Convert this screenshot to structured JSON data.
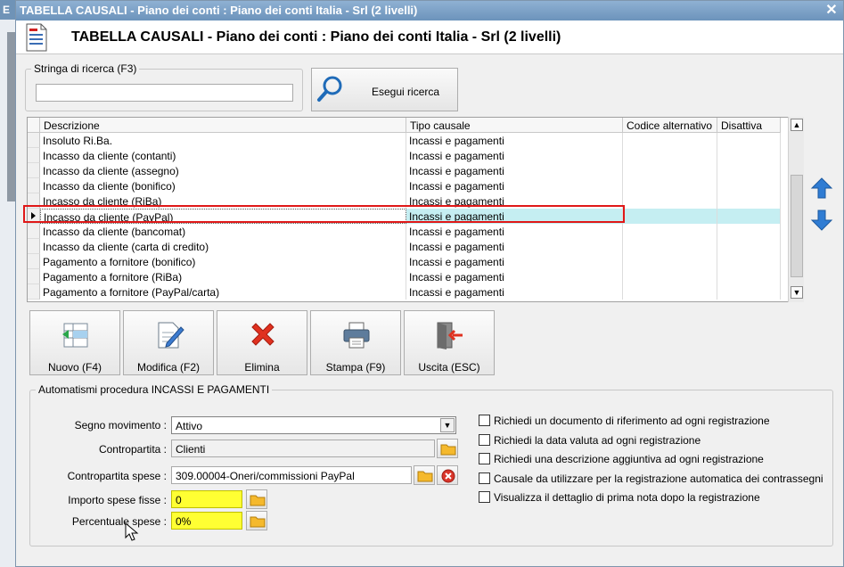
{
  "background_window": {
    "title_fragment": "E"
  },
  "window": {
    "title": "TABELLA CAUSALI - Piano dei conti : Piano dei conti Italia - Srl (2 livelli)",
    "close_label": "✕"
  },
  "header": {
    "title": "TABELLA CAUSALI - Piano dei conti : Piano dei conti Italia - Srl (2 livelli)",
    "icon": "document-icon"
  },
  "search": {
    "group_label": "Stringa di ricerca (F3)",
    "value": "",
    "placeholder": "",
    "button_label": "Esegui ricerca"
  },
  "grid": {
    "columns": [
      "Descrizione",
      "Tipo causale",
      "Codice alternativo",
      "Disattiva"
    ],
    "rows": [
      {
        "descrizione": "Insoluto Ri.Ba.",
        "tipo": "Incassi e pagamenti",
        "codice": "",
        "disattiva": ""
      },
      {
        "descrizione": "Incasso da cliente (contanti)",
        "tipo": "Incassi e pagamenti",
        "codice": "",
        "disattiva": ""
      },
      {
        "descrizione": "Incasso da cliente (assegno)",
        "tipo": "Incassi e pagamenti",
        "codice": "",
        "disattiva": ""
      },
      {
        "descrizione": "Incasso da cliente (bonifico)",
        "tipo": "Incassi e pagamenti",
        "codice": "",
        "disattiva": ""
      },
      {
        "descrizione": "Incasso da cliente (RiBa)",
        "tipo": "Incassi e pagamenti",
        "codice": "",
        "disattiva": ""
      },
      {
        "descrizione": "Incasso da cliente (PayPal)",
        "tipo": "Incassi e pagamenti",
        "codice": "",
        "disattiva": ""
      },
      {
        "descrizione": "Incasso da cliente (bancomat)",
        "tipo": "Incassi e pagamenti",
        "codice": "",
        "disattiva": ""
      },
      {
        "descrizione": "Incasso da cliente (carta di credito)",
        "tipo": "Incassi e pagamenti",
        "codice": "",
        "disattiva": ""
      },
      {
        "descrizione": "Pagamento a fornitore (bonifico)",
        "tipo": "Incassi e pagamenti",
        "codice": "",
        "disattiva": ""
      },
      {
        "descrizione": "Pagamento a fornitore (RiBa)",
        "tipo": "Incassi e pagamenti",
        "codice": "",
        "disattiva": ""
      },
      {
        "descrizione": "Pagamento a fornitore (PayPal/carta)",
        "tipo": "Incassi e pagamenti",
        "codice": "",
        "disattiva": ""
      }
    ],
    "selected_row": 5
  },
  "toolbar": {
    "nuovo": "Nuovo (F4)",
    "modifica": "Modifica (F2)",
    "elimina": "Elimina",
    "stampa": "Stampa (F9)",
    "uscita": "Uscita (ESC)"
  },
  "automatismi": {
    "group_label": "Automatismi procedura INCASSI E PAGAMENTI",
    "segno_label": "Segno movimento :",
    "segno_value": "Attivo",
    "contropartita_label": "Contropartita :",
    "contropartita_value": "Clienti",
    "spese_label": "Contropartita spese :",
    "spese_value": "309.00004-Oneri/commissioni PayPal",
    "importo_label": "Importo spese fisse :",
    "importo_value": "0",
    "percentuale_label": "Percentuale spese :",
    "percentuale_value": "0%",
    "checks": [
      {
        "label": "Richiedi un documento di riferimento ad ogni registrazione",
        "checked": false
      },
      {
        "label": "Richiedi la data valuta ad ogni registrazione",
        "checked": false
      },
      {
        "label": "Richiedi una descrizione aggiuntiva ad ogni registrazione",
        "checked": false
      },
      {
        "label": "Causale da utilizzare per la registrazione automatica dei contrassegni",
        "checked": false
      },
      {
        "label": "Visualizza il dettaglio di prima nota dopo la registrazione",
        "checked": false
      }
    ]
  },
  "colors": {
    "selected_row": "#c5eef2",
    "highlight": "#e01818",
    "yellow_field": "#ffff33",
    "title_bar": "#6c93bb"
  }
}
